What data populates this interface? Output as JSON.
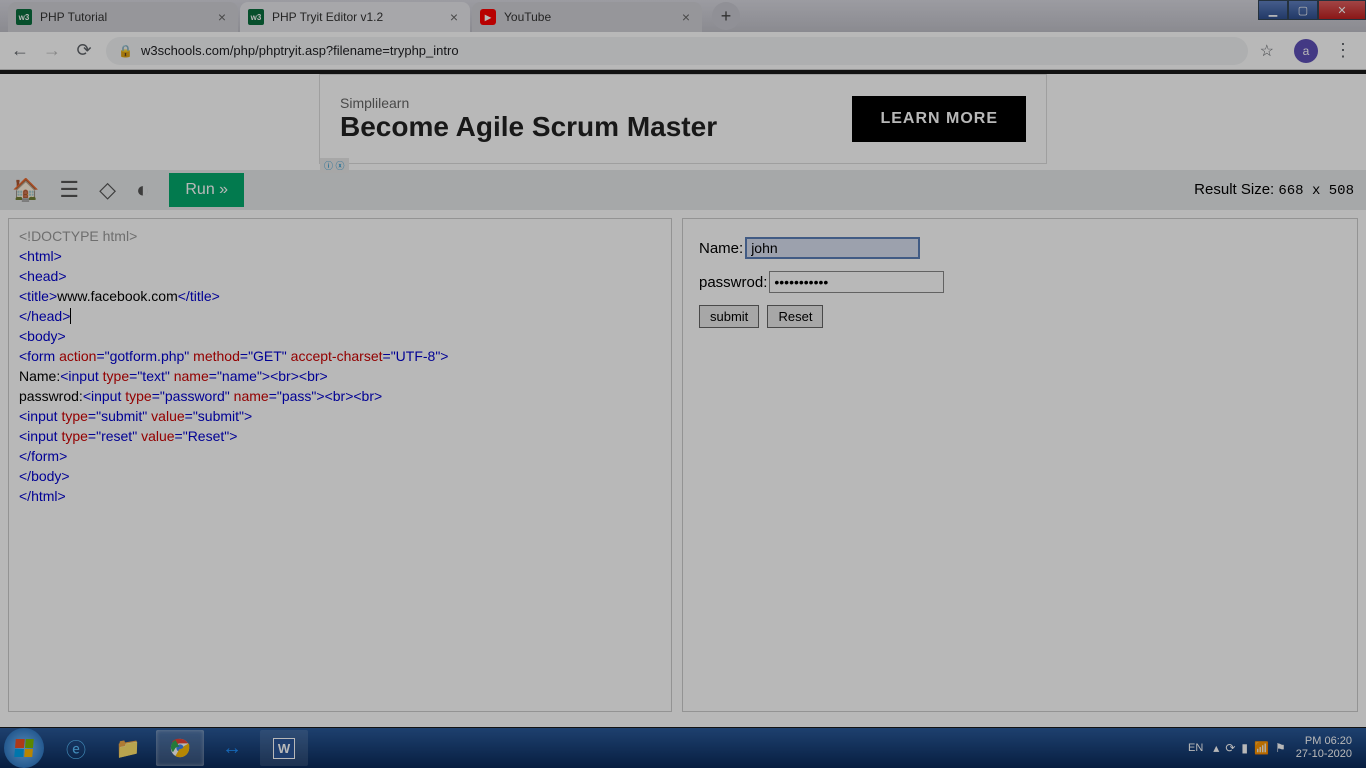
{
  "tabs": [
    {
      "title": "PHP Tutorial",
      "favicon": "w3",
      "active": false
    },
    {
      "title": "PHP Tryit Editor v1.2",
      "favicon": "w3",
      "active": true
    },
    {
      "title": "YouTube",
      "favicon": "yt",
      "active": false
    }
  ],
  "addressbar": {
    "url": "w3schools.com/php/phptryit.asp?filename=tryphp_intro",
    "profile_letter": "a"
  },
  "ad": {
    "brand": "Simplilearn",
    "headline": "Become Agile Scrum Master",
    "cta": "LEARN MORE",
    "badge": "ⓘ ⓧ"
  },
  "toolbar": {
    "run_label": "Run »",
    "result_size_label": "Result Size: ",
    "result_size_value": "668 x 508"
  },
  "code": {
    "lines": [
      [
        [
          "t-doctype",
          "<!DOCTYPE html>"
        ]
      ],
      [
        [
          "t-tag",
          "<html>"
        ]
      ],
      [
        [
          "t-tag",
          "<head>"
        ]
      ],
      [
        [
          "t-tag",
          "<title>"
        ],
        [
          "t-text",
          "www.facebook.com"
        ],
        [
          "t-tag",
          "</title>"
        ]
      ],
      [
        [
          "t-tag",
          "</head>"
        ],
        [
          "cursor",
          ""
        ]
      ],
      [
        [
          "t-tag",
          "<body>"
        ]
      ],
      [
        [
          "t-tag",
          "<form "
        ],
        [
          "t-attr",
          "action"
        ],
        [
          "t-tag",
          "="
        ],
        [
          "t-val",
          "\"gotform.php\""
        ],
        [
          "t-tag",
          " "
        ],
        [
          "t-attr",
          "method"
        ],
        [
          "t-tag",
          "="
        ],
        [
          "t-val",
          "\"GET\""
        ],
        [
          "t-tag",
          " "
        ],
        [
          "t-attr",
          "accept-charset"
        ],
        [
          "t-tag",
          "="
        ],
        [
          "t-val",
          "\"UTF-8\""
        ],
        [
          "t-tag",
          ">"
        ]
      ],
      [
        [
          "t-text",
          "Name:"
        ],
        [
          "t-tag",
          "<input "
        ],
        [
          "t-attr",
          "type"
        ],
        [
          "t-tag",
          "="
        ],
        [
          "t-val",
          "\"text\""
        ],
        [
          "t-tag",
          " "
        ],
        [
          "t-attr",
          "name"
        ],
        [
          "t-tag",
          "="
        ],
        [
          "t-val",
          "\"name\""
        ],
        [
          "t-tag",
          "><br><br>"
        ]
      ],
      [
        [
          "t-text",
          "passwrod:"
        ],
        [
          "t-tag",
          "<input "
        ],
        [
          "t-attr",
          "type"
        ],
        [
          "t-tag",
          "="
        ],
        [
          "t-val",
          "\"password\""
        ],
        [
          "t-tag",
          " "
        ],
        [
          "t-attr",
          "name"
        ],
        [
          "t-tag",
          "="
        ],
        [
          "t-val",
          "\"pass\""
        ],
        [
          "t-tag",
          "><br><br>"
        ]
      ],
      [
        [
          "t-tag",
          "<input "
        ],
        [
          "t-attr",
          "type"
        ],
        [
          "t-tag",
          "="
        ],
        [
          "t-val",
          "\"submit\""
        ],
        [
          "t-tag",
          " "
        ],
        [
          "t-attr",
          "value"
        ],
        [
          "t-tag",
          "="
        ],
        [
          "t-val",
          "\"submit\""
        ],
        [
          "t-tag",
          ">"
        ]
      ],
      [
        [
          "t-tag",
          "<input "
        ],
        [
          "t-attr",
          "type"
        ],
        [
          "t-tag",
          "="
        ],
        [
          "t-val",
          "\"reset\""
        ],
        [
          "t-tag",
          " "
        ],
        [
          "t-attr",
          "value"
        ],
        [
          "t-tag",
          "="
        ],
        [
          "t-val",
          "\"Reset\""
        ],
        [
          "t-tag",
          ">"
        ]
      ],
      [
        [
          "t-tag",
          "</form>"
        ]
      ],
      [
        [
          "t-tag",
          "</body>"
        ]
      ],
      [
        [
          "t-tag",
          "</html>"
        ]
      ]
    ]
  },
  "result_form": {
    "name_label": "Name:",
    "name_value": "john",
    "pass_label": "passwrod:",
    "pass_value": "•••••••••••",
    "submit_label": "submit",
    "reset_label": "Reset"
  },
  "taskbar": {
    "lang": "EN",
    "time": "PM 06:20",
    "date": "27-10-2020"
  }
}
